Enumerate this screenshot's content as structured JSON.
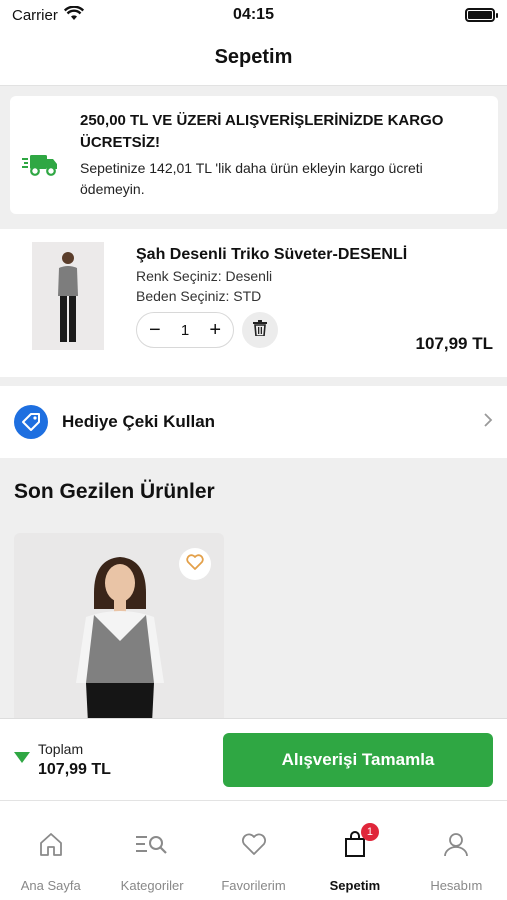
{
  "status": {
    "carrier": "Carrier",
    "time": "04:15"
  },
  "header": {
    "title": "Sepetim"
  },
  "shipping": {
    "title": "250,00 TL VE ÜZERİ ALIŞVERİŞLERİNİZDE KARGO ÜCRETSİZ!",
    "subtitle": "Sepetinize 142,01 TL 'lik daha ürün ekleyin kargo ücreti ödemeyin."
  },
  "cart": {
    "items": [
      {
        "name": "Şah Desenli Triko Süveter-DESENLİ",
        "color": "Renk Seçiniz: Desenli",
        "size": "Beden Seçiniz: STD",
        "quantity": "1",
        "price": "107,99 TL",
        "minus": "−",
        "plus": "+"
      }
    ]
  },
  "gift": {
    "label": "Hediye Çeki Kullan"
  },
  "recent": {
    "title": "Son Gezilen Ürünler"
  },
  "checkout": {
    "total_label": "Toplam",
    "total_value": "107,99 TL",
    "button": "Alışverişi Tamamla"
  },
  "tabs": [
    {
      "label": "Ana Sayfa",
      "icon": "home-icon"
    },
    {
      "label": "Kategoriler",
      "icon": "category-search-icon"
    },
    {
      "label": "Favorilerim",
      "icon": "heart-icon"
    },
    {
      "label": "Sepetim",
      "icon": "bag-icon",
      "badge": "1",
      "active": true
    },
    {
      "label": "Hesabım",
      "icon": "user-icon"
    }
  ],
  "colors": {
    "accent_green": "#2fa743",
    "gift_blue": "#1e6fe0",
    "badge_red": "#e0263a",
    "fav_orange": "#e3a04a"
  }
}
